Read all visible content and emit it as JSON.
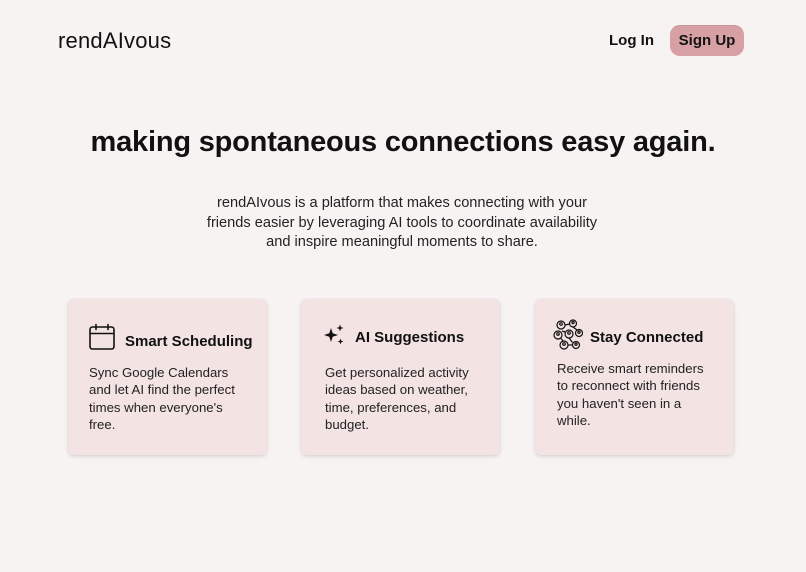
{
  "brand": {
    "logo_text": "rendAIvous"
  },
  "nav": {
    "login_label": "Log In",
    "signup_label": "Sign Up"
  },
  "hero": {
    "title": "making spontaneous connections easy again.",
    "subtitle": "rendAIvous is a platform that makes connecting with your friends easier by leveraging AI tools to coordinate availability and inspire meaningful moments to share."
  },
  "features": [
    {
      "icon": "calendar-icon",
      "title": "Smart Scheduling",
      "description": "Sync Google Calendars and let AI find the perfect times when everyone's free."
    },
    {
      "icon": "sparkles-icon",
      "title": "AI Suggestions",
      "description": "Get personalized activity ideas based on weather, time, preferences, and budget."
    },
    {
      "icon": "people-network-icon",
      "title": "Stay Connected",
      "description": "Receive smart reminders to reconnect with friends you haven't seen in a while."
    }
  ],
  "colors": {
    "background": "#f8f3f3",
    "card": "#f3e3e3",
    "signup_button": "#d7a0a4",
    "text": "#111111"
  }
}
